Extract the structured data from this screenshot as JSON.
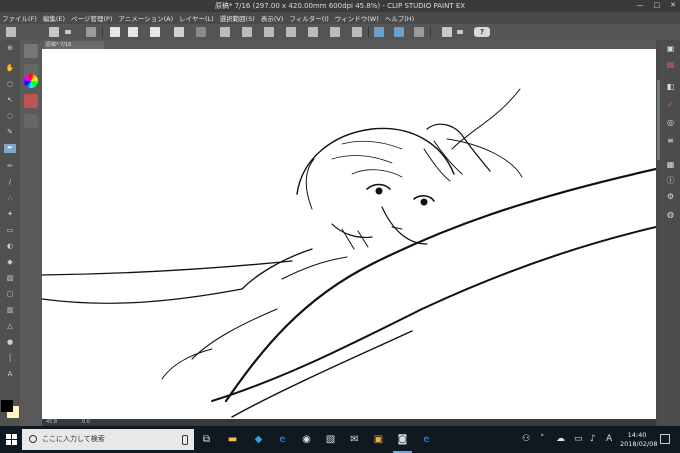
{
  "window": {
    "title": "原稿* 7/16 (297.00 x 420.00mm 600dpi 45.8%) - CLIP STUDIO PAINT EX",
    "minimize": "—",
    "maximize": "□",
    "close": "✕"
  },
  "menu": [
    "ファイル(F)",
    "編集(E)",
    "ページ管理(P)",
    "アニメーション(A)",
    "レイヤー(L)",
    "選択範囲(S)",
    "表示(V)",
    "フィルター(I)",
    "ウィンドウ(W)",
    "ヘルプ(H)"
  ],
  "help_label": "?",
  "tab": {
    "name": "原稿*  7/16"
  },
  "status": {
    "zoom": "45.8",
    "angle": "0.0"
  },
  "colors": {
    "main": "#000000",
    "sub": "#fff3c4"
  },
  "taskbar": {
    "search_placeholder": "ここに入力して検索",
    "time": "14:40",
    "date": "2018/02/08",
    "ime": "A"
  }
}
